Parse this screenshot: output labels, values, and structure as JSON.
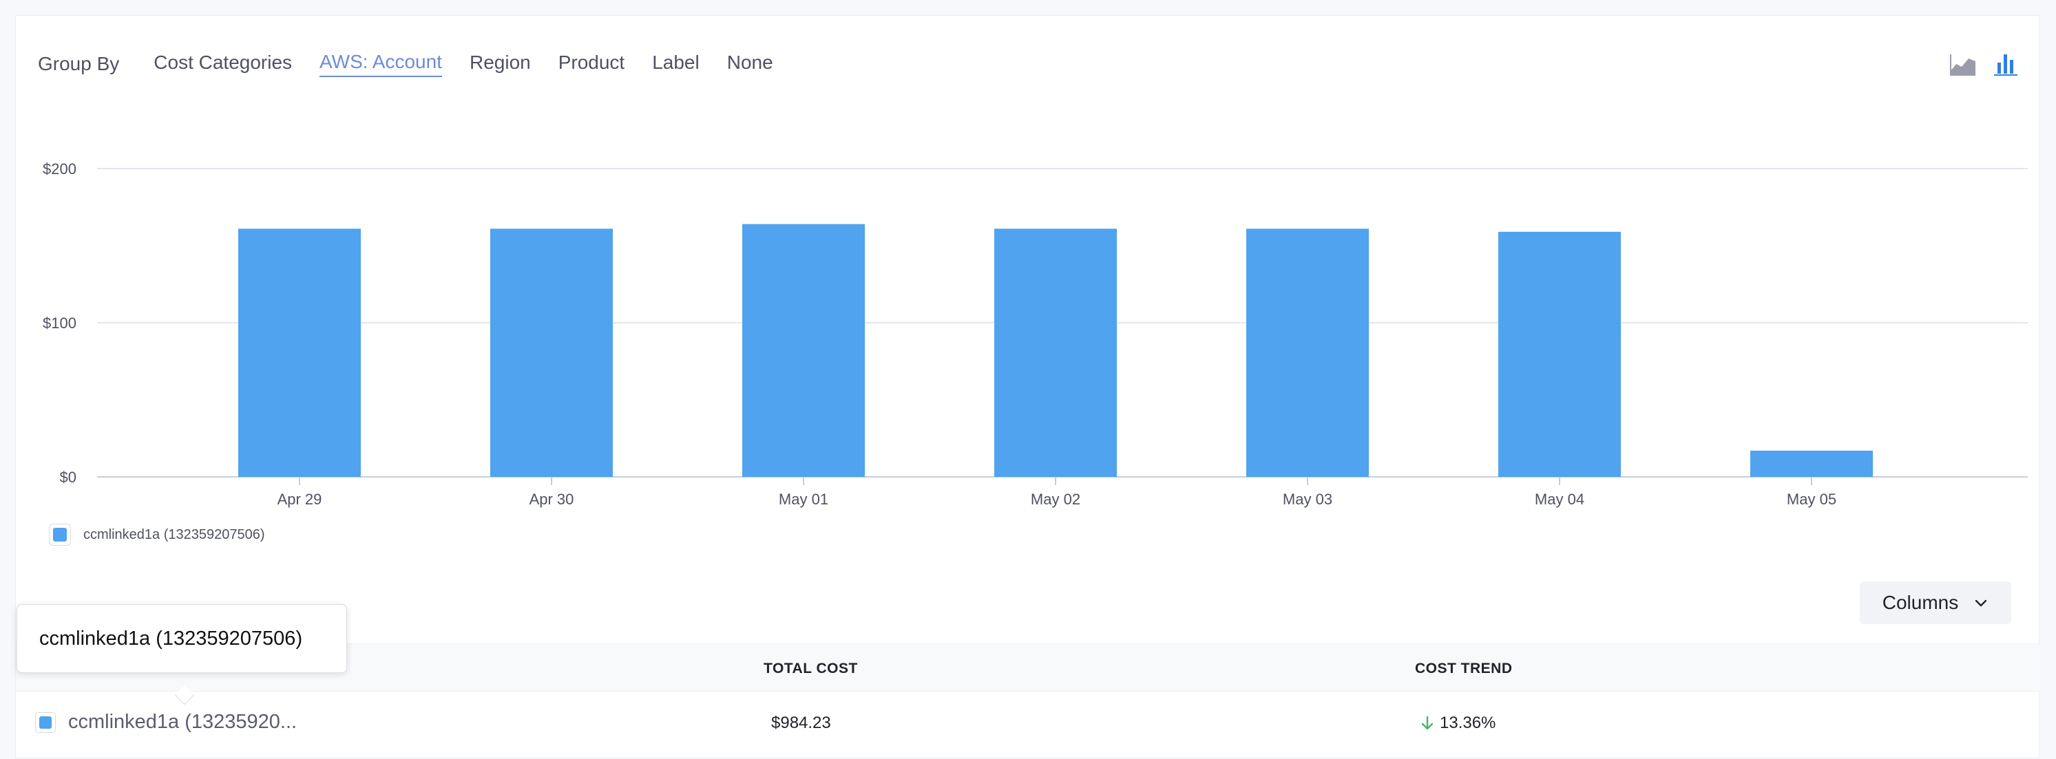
{
  "group_by": {
    "label": "Group By",
    "options": [
      "Cost Categories",
      "AWS: Account",
      "Region",
      "Product",
      "Label",
      "None"
    ],
    "active": "AWS: Account"
  },
  "chart_toggles": [
    {
      "name": "area-chart-icon",
      "active": false
    },
    {
      "name": "bar-chart-icon",
      "active": true
    }
  ],
  "chart_data": {
    "type": "bar",
    "categories": [
      "Apr 29",
      "Apr 30",
      "May 01",
      "May 02",
      "May 03",
      "May 04",
      "May 05"
    ],
    "series": [
      {
        "name": "ccmlinked1a (132359207506)",
        "values": [
          161,
          161,
          164,
          161,
          161,
          159,
          17
        ]
      }
    ],
    "y_ticks": [
      "$0",
      "$100",
      "$200"
    ],
    "ylim": [
      0,
      200
    ],
    "grid": true,
    "legend_position": "bottom-left",
    "color": "#4fa3ef"
  },
  "legend": {
    "label": "ccmlinked1a (132359207506)"
  },
  "columns_button": {
    "label": "Columns"
  },
  "table": {
    "headers": {
      "total_cost": "TOTAL COST",
      "cost_trend": "COST TREND"
    },
    "rows": [
      {
        "name": "ccmlinked1a (13235920...",
        "total_cost": "$984.23",
        "cost_trend": "13.36%",
        "trend_direction": "down"
      }
    ]
  },
  "tooltip": {
    "text": "ccmlinked1a (132359207506)"
  }
}
